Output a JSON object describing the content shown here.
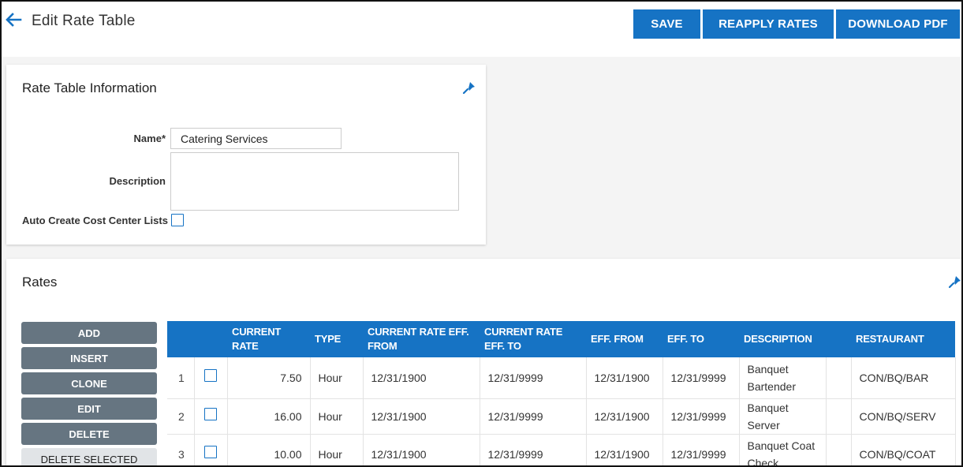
{
  "header": {
    "back_icon": "arrow-left-icon",
    "title": "Edit Rate Table",
    "buttons": {
      "save": "SAVE",
      "reapply": "REAPPLY RATES",
      "download": "DOWNLOAD PDF"
    }
  },
  "info": {
    "title": "Rate Table Information",
    "pin_icon": "pin-icon",
    "name_label": "Name*",
    "name_value": "Catering Services",
    "description_label": "Description",
    "description_value": "",
    "auto_create_label": "Auto Create Cost Center Lists",
    "auto_create_checked": false
  },
  "rates": {
    "title": "Rates",
    "pin_icon": "pin-icon",
    "actions": {
      "add": "ADD",
      "insert": "INSERT",
      "clone": "CLONE",
      "edit": "EDIT",
      "delete": "DELETE",
      "delete_selected": "DELETE SELECTED"
    },
    "columns": {
      "current_rate": "CURRENT RATE",
      "type": "TYPE",
      "eff_from_rate": "CURRENT RATE EFF. FROM",
      "eff_to_rate": "CURRENT RATE EFF. TO",
      "eff_from": "EFF. FROM",
      "eff_to": "EFF. TO",
      "description": "DESCRIPTION",
      "restaurant": "RESTAURANT"
    },
    "rows": [
      {
        "index": "1",
        "rate": "7.50",
        "type": "Hour",
        "rate_from": "12/31/1900",
        "rate_to": "12/31/9999",
        "eff_from": "12/31/1900",
        "eff_to": "12/31/9999",
        "description": "Banquet Bartender",
        "restaurant": "CON/BQ/BAR"
      },
      {
        "index": "2",
        "rate": "16.00",
        "type": "Hour",
        "rate_from": "12/31/1900",
        "rate_to": "12/31/9999",
        "eff_from": "12/31/1900",
        "eff_to": "12/31/9999",
        "description": "Banquet Server",
        "restaurant": "CON/BQ/SERV"
      },
      {
        "index": "3",
        "rate": "10.00",
        "type": "Hour",
        "rate_from": "12/31/1900",
        "rate_to": "12/31/9999",
        "eff_from": "12/31/1900",
        "eff_to": "12/31/9999",
        "description": "Banquet Coat Check",
        "restaurant": "CON/BQ/COAT"
      }
    ]
  },
  "colors": {
    "accent": "#1673c4",
    "side_button": "#667581",
    "side_button_light": "#e1e4e7"
  }
}
